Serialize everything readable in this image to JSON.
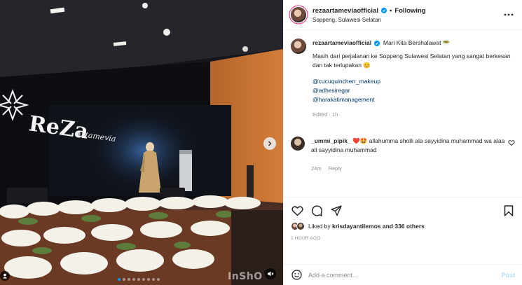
{
  "post": {
    "username": "rezaartameviaofficial",
    "follow_label": "Following",
    "separator": "•",
    "location": "Soppeng, Sulawesi Selatan",
    "caption_title": "Mari Kita Bershalawat 🥗",
    "caption_text": "Masih dari perjalanan ke Soppeng Sulawesi Selatan yang sangat berkesan dan tak terlupakan 😊",
    "mentions": [
      "@cucuquincherr_makeup",
      "@adhesiregar",
      "@harakatimanagement"
    ],
    "caption_meta": "Edited · 1h"
  },
  "comment": {
    "username": "_ummi_pipik_",
    "emojis": "❤️🤩",
    "text": "allahumma sholli ala sayyidina muhammad wa alaa ali sayyidina muhammad",
    "age": "24m",
    "reply_label": "Reply"
  },
  "likes": {
    "prefix": "Liked by",
    "user": "krisdayantilemos",
    "suffix": "and 336 others"
  },
  "timestamp": "1 HOUR AGO",
  "composer": {
    "placeholder": "Add a comment...",
    "post_label": "Post"
  },
  "media": {
    "stage_logo": "ReZa",
    "stage_logo_sub": "Artamevia",
    "watermark": "InShO",
    "carousel_count": 9,
    "carousel_active": 1
  },
  "colors": {
    "accent": "#0095f6",
    "story_ring": "#d62976",
    "post_disabled": "#b2dffc"
  }
}
